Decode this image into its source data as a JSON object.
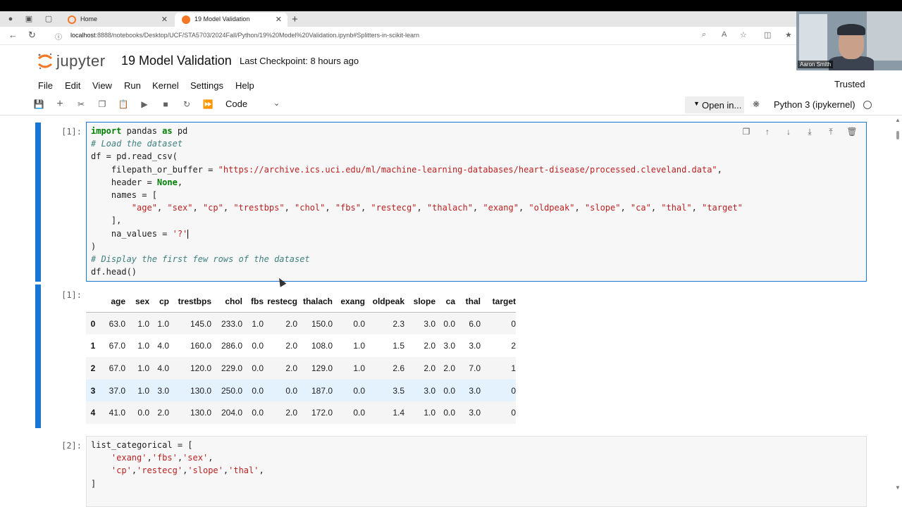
{
  "browser": {
    "tabs": [
      {
        "label": "Home",
        "active": false
      },
      {
        "label": "19 Model Validation",
        "active": true
      }
    ],
    "url_host": "localhost",
    "url_rest": ":8888/notebooks/Desktop/UCF/STA5703/2024Fall/Python/19%20Model%20Validation.ipynb#Splitters-in-scikit-learn"
  },
  "header": {
    "logo_word": "jupyter",
    "notebook_title": "19 Model Validation",
    "checkpoint": "Last Checkpoint: 8 hours ago",
    "webcam_name": "Aaron Smith"
  },
  "menu": [
    "File",
    "Edit",
    "View",
    "Run",
    "Kernel",
    "Settings",
    "Help"
  ],
  "trusted": "Trusted",
  "toolbar": {
    "cell_type": "Code",
    "open_in": "Open in...",
    "kernel": "Python 3 (ipykernel)"
  },
  "cells": {
    "cell1_prompt": "[1]:",
    "cell1_code": [
      [
        {
          "t": "import",
          "c": "kw"
        },
        {
          "t": " pandas "
        },
        {
          "t": "as",
          "c": "kw"
        },
        {
          "t": " pd"
        }
      ],
      [
        {
          "t": "# Load the dataset",
          "c": "cm"
        }
      ],
      [
        {
          "t": "df = pd.read_csv("
        }
      ],
      [
        {
          "t": "    filepath_or_buffer = "
        },
        {
          "t": "\"https://archive.ics.uci.edu/ml/machine-learning-databases/heart-disease/processed.cleveland.data\"",
          "c": "str"
        },
        {
          "t": ","
        }
      ],
      [
        {
          "t": "    header = "
        },
        {
          "t": "None",
          "c": "kw"
        },
        {
          "t": ","
        }
      ],
      [
        {
          "t": "    names = ["
        }
      ],
      [
        {
          "t": "        "
        },
        {
          "t": "\"age\"",
          "c": "str"
        },
        {
          "t": ", "
        },
        {
          "t": "\"sex\"",
          "c": "str"
        },
        {
          "t": ", "
        },
        {
          "t": "\"cp\"",
          "c": "str"
        },
        {
          "t": ", "
        },
        {
          "t": "\"trestbps\"",
          "c": "str"
        },
        {
          "t": ", "
        },
        {
          "t": "\"chol\"",
          "c": "str"
        },
        {
          "t": ", "
        },
        {
          "t": "\"fbs\"",
          "c": "str"
        },
        {
          "t": ", "
        },
        {
          "t": "\"restecg\"",
          "c": "str"
        },
        {
          "t": ", "
        },
        {
          "t": "\"thalach\"",
          "c": "str"
        },
        {
          "t": ", "
        },
        {
          "t": "\"exang\"",
          "c": "str"
        },
        {
          "t": ", "
        },
        {
          "t": "\"oldpeak\"",
          "c": "str"
        },
        {
          "t": ", "
        },
        {
          "t": "\"slope\"",
          "c": "str"
        },
        {
          "t": ", "
        },
        {
          "t": "\"ca\"",
          "c": "str"
        },
        {
          "t": ", "
        },
        {
          "t": "\"thal\"",
          "c": "str"
        },
        {
          "t": ", "
        },
        {
          "t": "\"target\"",
          "c": "str"
        }
      ],
      [
        {
          "t": "    ],"
        }
      ],
      [
        {
          "t": "    na_values = "
        },
        {
          "t": "'?'",
          "c": "str"
        },
        {
          "t": "",
          "cursor": true
        }
      ],
      [
        {
          "t": ")"
        }
      ],
      [
        {
          "t": "# Display the first few rows of the dataset",
          "c": "cm"
        }
      ],
      [
        {
          "t": "df.head()"
        }
      ]
    ],
    "output1_prompt": "[1]:",
    "cell2_prompt": "[2]:",
    "cell2_code": [
      [
        {
          "t": "list_categorical = ["
        }
      ],
      [
        {
          "t": "    "
        },
        {
          "t": "'exang'",
          "c": "str"
        },
        {
          "t": ","
        },
        {
          "t": "'fbs'",
          "c": "str"
        },
        {
          "t": ","
        },
        {
          "t": "'sex'",
          "c": "str"
        },
        {
          "t": ","
        }
      ],
      [
        {
          "t": "    "
        },
        {
          "t": "'cp'",
          "c": "str"
        },
        {
          "t": ","
        },
        {
          "t": "'restecg'",
          "c": "str"
        },
        {
          "t": ","
        },
        {
          "t": "'slope'",
          "c": "str"
        },
        {
          "t": ","
        },
        {
          "t": "'thal'",
          "c": "str"
        },
        {
          "t": ","
        }
      ],
      [
        {
          "t": "]"
        }
      ]
    ]
  },
  "dataframe": {
    "columns": [
      "",
      "age",
      "sex",
      "cp",
      "trestbps",
      "chol",
      "fbs",
      "restecg",
      "thalach",
      "exang",
      "oldpeak",
      "slope",
      "ca",
      "thal",
      "target"
    ],
    "rows": [
      [
        "0",
        "63.0",
        "1.0",
        "1.0",
        "145.0",
        "233.0",
        "1.0",
        "2.0",
        "150.0",
        "0.0",
        "2.3",
        "3.0",
        "0.0",
        "6.0",
        "0"
      ],
      [
        "1",
        "67.0",
        "1.0",
        "4.0",
        "160.0",
        "286.0",
        "0.0",
        "2.0",
        "108.0",
        "1.0",
        "1.5",
        "2.0",
        "3.0",
        "3.0",
        "2"
      ],
      [
        "2",
        "67.0",
        "1.0",
        "4.0",
        "120.0",
        "229.0",
        "0.0",
        "2.0",
        "129.0",
        "1.0",
        "2.6",
        "2.0",
        "2.0",
        "7.0",
        "1"
      ],
      [
        "3",
        "37.0",
        "1.0",
        "3.0",
        "130.0",
        "250.0",
        "0.0",
        "0.0",
        "187.0",
        "0.0",
        "3.5",
        "3.0",
        "0.0",
        "3.0",
        "0"
      ],
      [
        "4",
        "41.0",
        "0.0",
        "2.0",
        "130.0",
        "204.0",
        "0.0",
        "2.0",
        "172.0",
        "0.0",
        "1.4",
        "1.0",
        "0.0",
        "3.0",
        "0"
      ]
    ],
    "hover_row": 3
  },
  "colors": {
    "accent": "#1976d2",
    "keyword": "#008000",
    "string": "#ba2121",
    "comment": "#408080",
    "jupyter_orange": "#f37726"
  }
}
